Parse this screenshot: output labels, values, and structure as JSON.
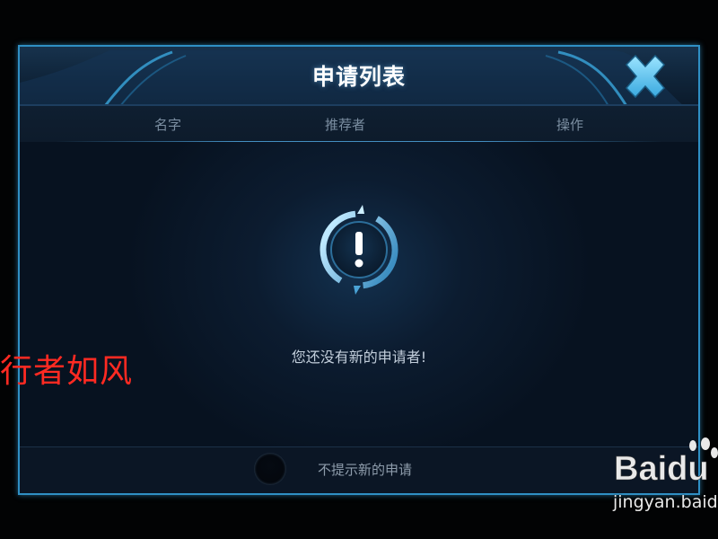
{
  "dialog": {
    "title": "申请列表",
    "close_icon": "close-x-icon"
  },
  "columns": [
    {
      "label": "名字"
    },
    {
      "label": "推荐者"
    },
    {
      "label": "操作"
    }
  ],
  "empty_state": {
    "icon": "exclamation-warning-icon",
    "message": "您还没有新的申请者!"
  },
  "footer": {
    "option_label": "不提示新的申请",
    "option_checked": false
  },
  "watermarks": {
    "author_text": "行者如风",
    "logo_text": "Baidu",
    "site_text": "jingyan.baidu"
  },
  "colors": {
    "accent": "#2f8fc4",
    "close_icon": "#5fc6f2",
    "watermark_red": "#ff2a22"
  }
}
